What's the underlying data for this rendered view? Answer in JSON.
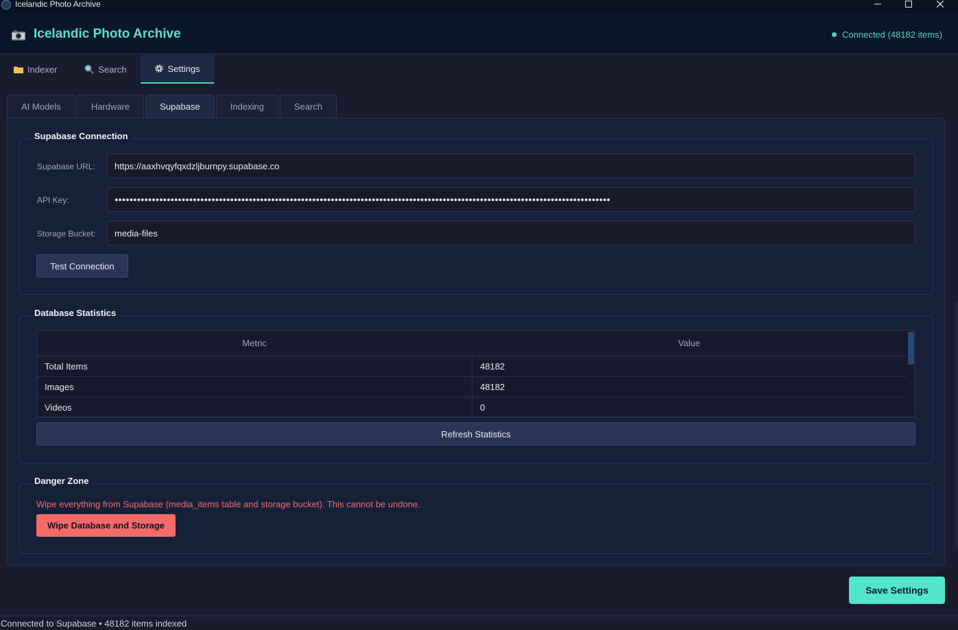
{
  "window": {
    "title": "Icelandic Photo Archive"
  },
  "header": {
    "title": "Icelandic Photo Archive",
    "camera_icon": "camera-icon",
    "status": "Connected (48182 items)"
  },
  "main_tabs": [
    {
      "label": "Indexer",
      "icon": "folder-icon"
    },
    {
      "label": "Search",
      "icon": "magnifier-icon"
    },
    {
      "label": "Settings",
      "icon": "gear-icon",
      "active": true
    }
  ],
  "sub_tabs": [
    {
      "label": "AI Models"
    },
    {
      "label": "Hardware"
    },
    {
      "label": "Supabase",
      "active": true
    },
    {
      "label": "Indexing"
    },
    {
      "label": "Search"
    }
  ],
  "supabase": {
    "group_title": "Supabase Connection",
    "url_label": "Supabase URL:",
    "url_value": "https://aaxhvqyfqxdzljburnpy.supabase.co",
    "api_key_label": "API Key:",
    "api_key_value": "●●●●●●●●●●●●●●●●●●●●●●●●●●●●●●●●●●●●●●●●●●●●●●●●●●●●●●●●●●●●●●●●●●●●●●●●●●●●●●●●●●●●●●●●●●●●●●●●●●●●●●●●●●●●●●●●●●●●●●●●●●●●●●●●●●●●●",
    "bucket_label": "Storage Bucket:",
    "bucket_value": "media-files",
    "test_button": "Test Connection"
  },
  "stats": {
    "group_title": "Database Statistics",
    "columns": [
      "Metric",
      "Value"
    ],
    "rows": [
      [
        "Total Items",
        "48182"
      ],
      [
        "Images",
        "48182"
      ],
      [
        "Videos",
        "0"
      ]
    ],
    "refresh_button": "Refresh Statistics"
  },
  "danger": {
    "group_title": "Danger Zone",
    "warning": "Wipe everything from Supabase (media_items table and storage bucket). This cannot be undone.",
    "wipe_button": "Wipe Database and Storage"
  },
  "save_button": "Save Settings",
  "statusbar": "Connected to Supabase • 48182 items indexed",
  "colors": {
    "accent": "#52e6c8",
    "danger": "#f36a6a",
    "background": "#1a1c2e",
    "panel": "#172039"
  }
}
